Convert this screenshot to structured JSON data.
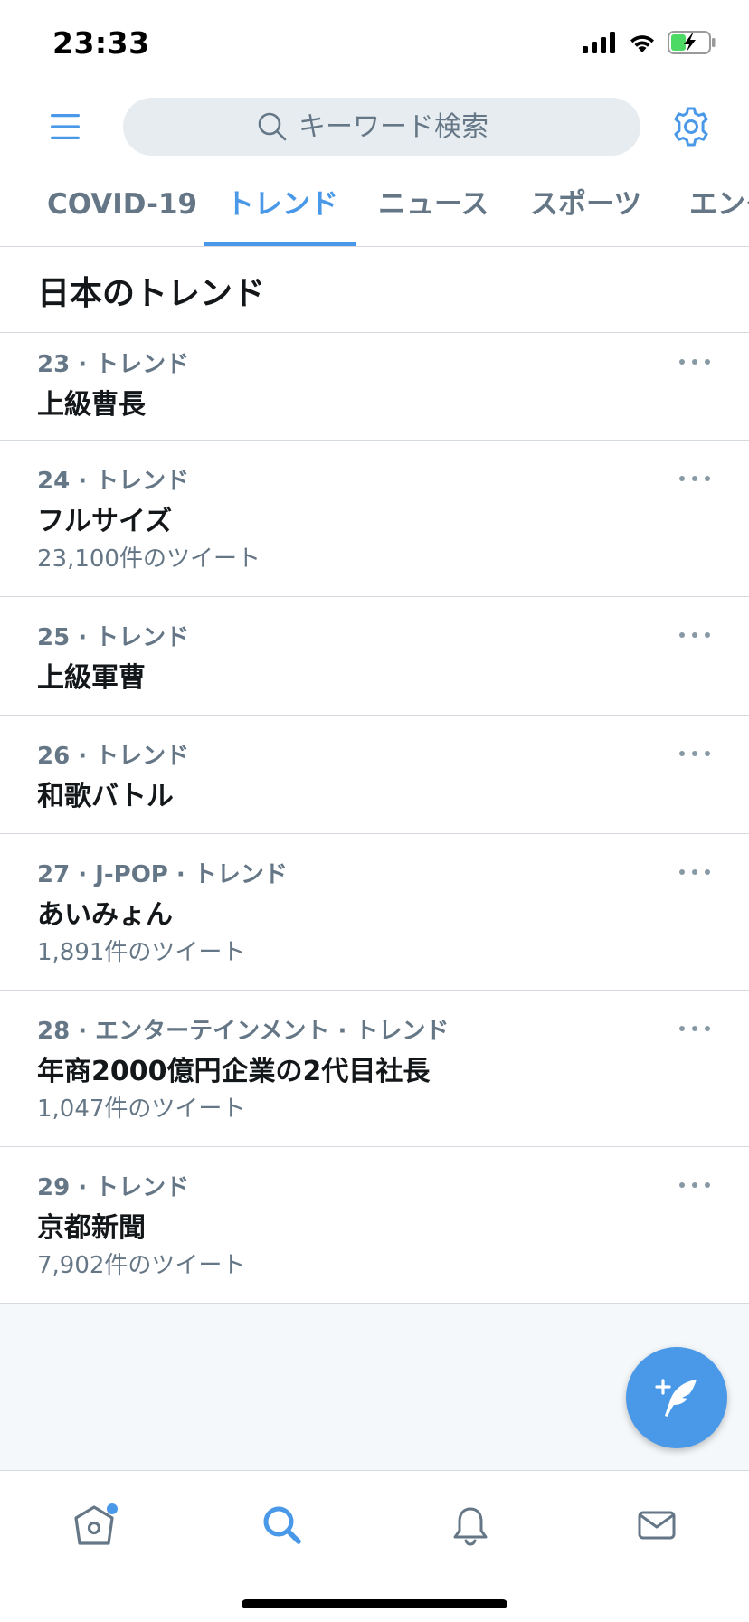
{
  "status_bar": {
    "time": "23:33"
  },
  "header": {
    "search_placeholder": "キーワード検索"
  },
  "tabs": [
    {
      "label": "COVID-19",
      "active": false
    },
    {
      "label": "トレンド",
      "active": true
    },
    {
      "label": "ニュース",
      "active": false
    },
    {
      "label": "スポーツ",
      "active": false
    },
    {
      "label": "エンタ",
      "active": false
    }
  ],
  "section": {
    "title": "日本のトレンド"
  },
  "trends": [
    {
      "rank": "23",
      "category": "トレンド",
      "name": "上級曹長",
      "count": ""
    },
    {
      "rank": "24",
      "category": "トレンド",
      "name": "フルサイズ",
      "count": "23,100件のツイート"
    },
    {
      "rank": "25",
      "category": "トレンド",
      "name": "上級軍曹",
      "count": ""
    },
    {
      "rank": "26",
      "category": "トレンド",
      "name": "和歌バトル",
      "count": ""
    },
    {
      "rank": "27",
      "category": "J-POP · トレンド",
      "name": "あいみょん",
      "count": "1,891件のツイート"
    },
    {
      "rank": "28",
      "category": "エンターテインメント · トレンド",
      "name": "年商2000億円企業の2代目社長",
      "count": "1,047件のツイート"
    },
    {
      "rank": "29",
      "category": "トレンド",
      "name": "京都新聞",
      "count": "7,902件のツイート"
    }
  ],
  "colors": {
    "accent": "#4a99e9",
    "text_primary": "#14171a",
    "text_secondary": "#657786",
    "divider": "#d4dadf",
    "battery_green": "#4cd964"
  },
  "icons": {
    "menu": "hamburger-menu-icon",
    "search": "search-icon",
    "settings": "gear-icon",
    "more": "more-dots-icon",
    "compose": "compose-tweet-icon",
    "home": "home-icon",
    "explore": "search-icon",
    "notifications": "bell-icon",
    "messages": "mail-icon"
  }
}
